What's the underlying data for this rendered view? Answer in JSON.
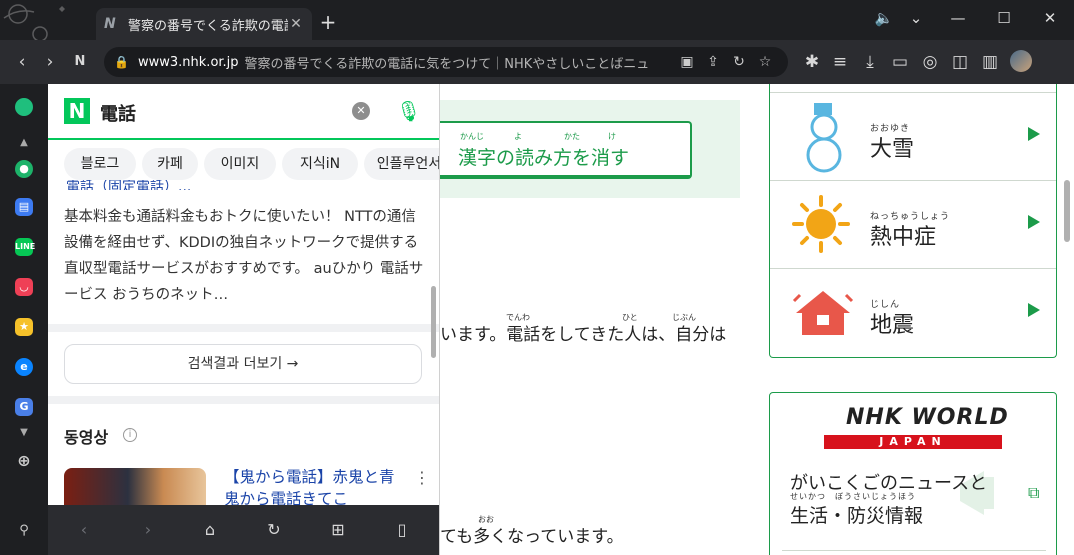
{
  "browser": {
    "tab_title": "警察の番号でくる詐欺の電話",
    "url": "www3.nhk.or.jp",
    "page_title": "警察の番号でくる詐欺の電話に気をつけて｜NHKやさしいことばニュ"
  },
  "panel": {
    "query": "電話",
    "chips": [
      "블로그",
      "카페",
      "이미지",
      "지식iN",
      "인플루언서"
    ],
    "cut_title": "電話（固定電話）...",
    "snippet": "基本料金も通話料金もおトクに使いたい！ NTTの通信設備を経由せず、KDDIの独自ネットワークで提供する直収型電話サービスがおすすめです。 auひかり 電話サービス おうちのネット…",
    "more_label": "검색결과 더보기 →",
    "video_heading": "동영상",
    "video_link": "【鬼から電話】赤鬼と青鬼から電話きてこ"
  },
  "main": {
    "kanji_button": "漢字の読み方を消す",
    "kanji_ruby": [
      "かんじ",
      "よ",
      "かた",
      "け"
    ],
    "line1": "います。電話をしてきた人は、自分は",
    "line1_ruby": [
      "でんわ",
      "ひと",
      "じぶん"
    ],
    "line2": "ても多くなっています。",
    "line2_ruby": [
      "おお"
    ],
    "disasters": [
      {
        "name": "大雪",
        "furi": "おおゆき",
        "icon": "snowman-icon"
      },
      {
        "name": "熱中症",
        "furi": "ねっちゅうしょう",
        "icon": "sun-icon"
      },
      {
        "name": "地震",
        "furi": "じしん",
        "icon": "house-quake-icon"
      }
    ],
    "world": {
      "logo": "NHK WORLD",
      "logo_sub": "JAPAN",
      "text1": "がいこくごのニュースと",
      "text2": "生活・防災情報",
      "text2_ruby": "せいかつ　ぼうさいじょうほう"
    }
  }
}
